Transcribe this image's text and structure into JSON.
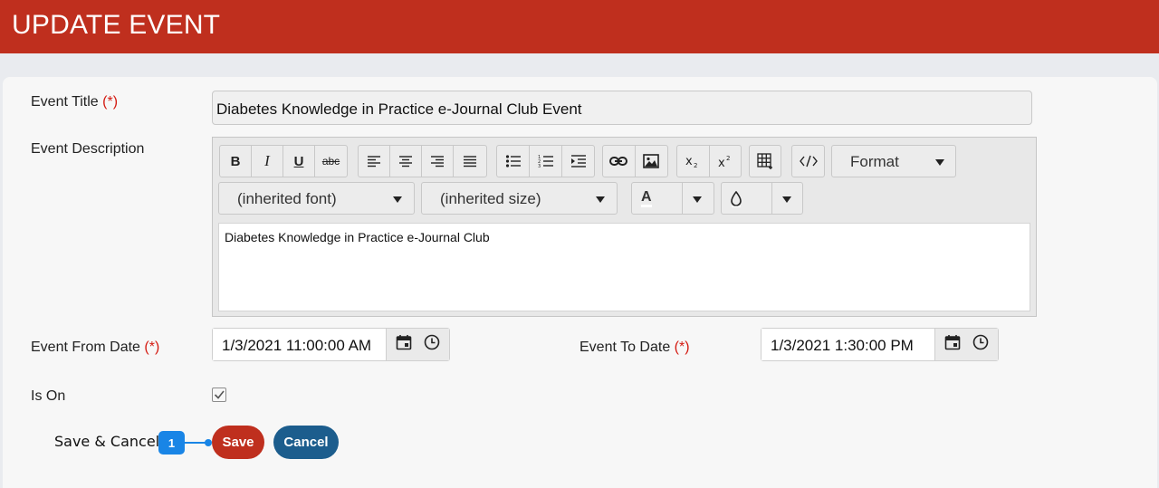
{
  "header": {
    "title": "UPDATE EVENT"
  },
  "form": {
    "required_marker": "(*)",
    "event_title": {
      "label": "Event Title",
      "value": "Diabetes Knowledge in Practice e-Journal Club Event"
    },
    "event_description": {
      "label": "Event Description",
      "content": "Diabetes Knowledge in Practice e-Journal Club",
      "toolbar": {
        "bold": "B",
        "italic": "I",
        "underline": "U",
        "strike": "abc",
        "format_label": "Format",
        "font_select": "(inherited font)",
        "size_select": "(inherited size)",
        "font_color_glyph": "A"
      }
    },
    "event_from_date": {
      "label": "Event From Date",
      "value": "1/3/2021 11:00:00 AM"
    },
    "event_to_date": {
      "label": "Event To Date",
      "value": "1/3/2021 1:30:00 PM"
    },
    "is_on": {
      "label": "Is On",
      "checked": true
    }
  },
  "actions": {
    "save_label": "Save",
    "cancel_label": "Cancel"
  },
  "annotation": {
    "label": "Save & Cancel",
    "badge": "1"
  },
  "colors": {
    "brand_red": "#bf2f1e",
    "cancel_blue": "#1c5d8d",
    "annotation_blue": "#1985e6",
    "required_red": "#d41b12"
  }
}
